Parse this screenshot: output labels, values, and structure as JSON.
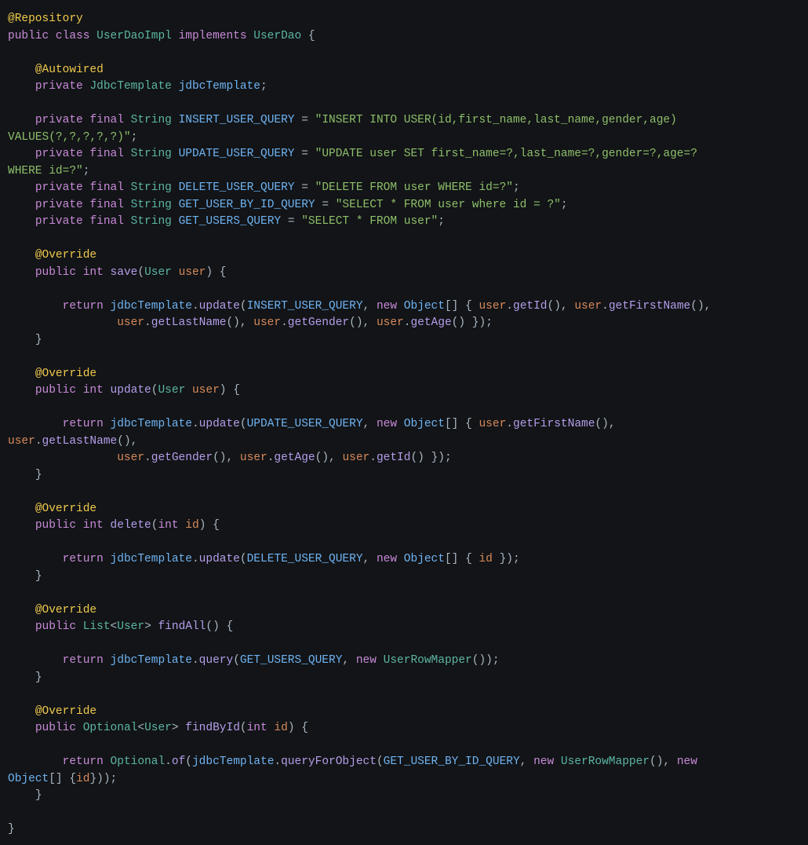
{
  "code": {
    "annotations": {
      "repository": "@Repository",
      "autowired": "@Autowired",
      "override": "@Override"
    },
    "keywords": {
      "public": "public",
      "class": "class",
      "implements": "implements",
      "private": "private",
      "final": "final",
      "return": "return",
      "new": "new",
      "int": "int"
    },
    "types": {
      "UserDaoImpl": "UserDaoImpl",
      "UserDao": "UserDao",
      "JdbcTemplate": "JdbcTemplate",
      "String": "String",
      "User": "User",
      "List": "List",
      "Optional": "Optional",
      "UserRowMapper": "UserRowMapper",
      "Object": "Object"
    },
    "fields": {
      "jdbcTemplate": "jdbcTemplate",
      "INSERT_USER_QUERY": "INSERT_USER_QUERY",
      "UPDATE_USER_QUERY": "UPDATE_USER_QUERY",
      "DELETE_USER_QUERY": "DELETE_USER_QUERY",
      "GET_USER_BY_ID_QUERY": "GET_USER_BY_ID_QUERY",
      "GET_USERS_QUERY": "GET_USERS_QUERY"
    },
    "strings": {
      "insert_a": "\"INSERT INTO USER(id,first_name,last_name,gender,age) ",
      "insert_b": "VALUES(?,?,?,?,?)\"",
      "update_a": "\"UPDATE user SET first_name=?,last_name=?,gender=?,age=? ",
      "update_b": "WHERE id=?\"",
      "delete": "\"DELETE FROM user WHERE id=?\"",
      "getById": "\"SELECT * FROM user where id = ?\"",
      "getAll": "\"SELECT * FROM user\""
    },
    "declMethods": {
      "save": "save",
      "update": "update",
      "delete": "delete",
      "findAll": "findAll",
      "findById": "findById"
    },
    "methods": {
      "update": "update",
      "getId": "getId",
      "getFirstName": "getFirstName",
      "getLastName": "getLastName",
      "getGender": "getGender",
      "getAge": "getAge",
      "query": "query",
      "of": "of",
      "queryForObject": "queryForObject"
    },
    "params": {
      "user": "user",
      "id": "id"
    },
    "punc": {
      "openBrace": "{",
      "closeBrace": "}",
      "openParen": "(",
      "closeParen": ")",
      "openBracket": "[",
      "closeBracket": "]",
      "lt": "<",
      "gt": ">",
      "semi": ";",
      "comma": ",",
      "dot": ".",
      "eq": "=",
      "sp1": " ",
      "sp4": "    ",
      "sp8": "        ",
      "sp16": "                "
    }
  }
}
